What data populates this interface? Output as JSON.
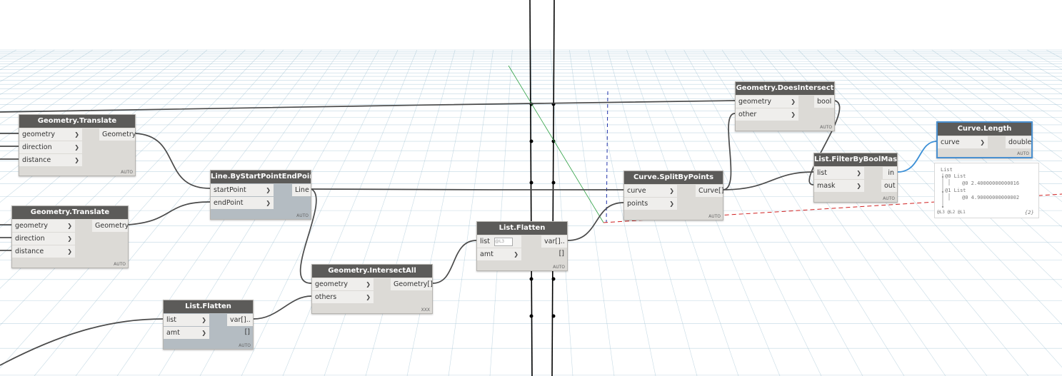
{
  "canvas": {
    "background": "#ffffff",
    "grid_color": "#8fb8cc",
    "wire_color": "#4a4a4a",
    "selected_wire_color": "#3b8fd6"
  },
  "nodes": {
    "translate1": {
      "title": "Geometry.Translate",
      "inputs": [
        "geometry",
        "direction",
        "distance"
      ],
      "output": "Geometry",
      "lacing": "AUTO"
    },
    "translate2": {
      "title": "Geometry.Translate",
      "inputs": [
        "geometry",
        "direction",
        "distance"
      ],
      "output": "Geometry",
      "lacing": "AUTO"
    },
    "line": {
      "title": "Line.ByStartPointEndPoint",
      "inputs": [
        "startPoint",
        "endPoint"
      ],
      "output": "Line",
      "lacing": "AUTO"
    },
    "flatten1": {
      "title": "List.Flatten",
      "inputs": [
        "list",
        "amt"
      ],
      "output": "var[]..[]",
      "lacing": "AUTO"
    },
    "intersect": {
      "title": "Geometry.IntersectAll",
      "inputs": [
        "geometry",
        "others"
      ],
      "output": "Geometry[]",
      "lacing": "XXX"
    },
    "flatten2": {
      "title": "List.Flatten",
      "inputs": [
        "list",
        "amt"
      ],
      "output": "var[]..[]",
      "lacing": "AUTO",
      "level_label": "@L3"
    },
    "split": {
      "title": "Curve.SplitByPoints",
      "inputs": [
        "curve",
        "points"
      ],
      "output": "Curve[]",
      "lacing": "AUTO"
    },
    "does_intersect": {
      "title": "Geometry.DoesIntersect",
      "inputs": [
        "geometry",
        "other"
      ],
      "output": "bool",
      "lacing": "AUTO"
    },
    "filter": {
      "title": "List.FilterByBoolMask",
      "inputs": [
        "list",
        "mask"
      ],
      "outputs": [
        "in",
        "out"
      ],
      "lacing": "AUTO"
    },
    "length": {
      "title": "Curve.Length",
      "inputs": [
        "curve"
      ],
      "output": "double",
      "lacing": "AUTO"
    }
  },
  "preview": {
    "lines": [
      "List",
      "@0 List",
      "@0 2.40000000000016",
      "@1 List",
      "@0 4.90000000000002"
    ],
    "levels": "@L3 @L2 @L1",
    "count": "{2}"
  }
}
